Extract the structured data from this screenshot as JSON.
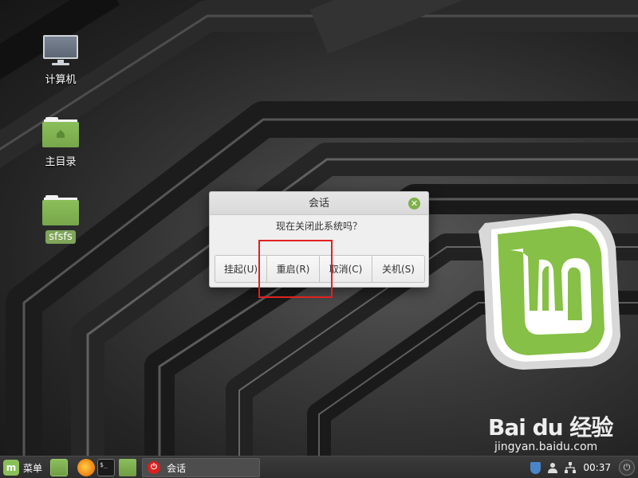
{
  "desktop": {
    "icons": [
      {
        "label": "计算机",
        "icon": "computer-icon"
      },
      {
        "label": "主目录",
        "icon": "home-folder-icon"
      },
      {
        "label": "sfsfs",
        "icon": "folder-icon"
      }
    ]
  },
  "dialog": {
    "title": "会话",
    "message": "现在关闭此系统吗？",
    "close_icon": "close-icon",
    "buttons": {
      "suspend": "挂起(U)",
      "restart": "重启(R)",
      "cancel": "取消(C)",
      "shutdown": "关机(S)"
    }
  },
  "annotation": {
    "highlight_color": "#e02020"
  },
  "watermark": {
    "brand": "Bai du 经验",
    "site": "jingyan.baidu.com"
  },
  "panel": {
    "menu_label": "菜单",
    "launchers": [
      "show-desktop-icon",
      "firefox-icon",
      "terminal-icon",
      "files-icon"
    ],
    "task": {
      "label": "会话",
      "icon": "power-icon"
    },
    "tray": {
      "icons": [
        "shield-icon",
        "user-icon",
        "network-icon"
      ],
      "clock": "00:37"
    }
  },
  "colors": {
    "mint_green": "#8bbf5a",
    "panel_bg": "#2d2d2d",
    "dialog_bg": "#efefef"
  }
}
